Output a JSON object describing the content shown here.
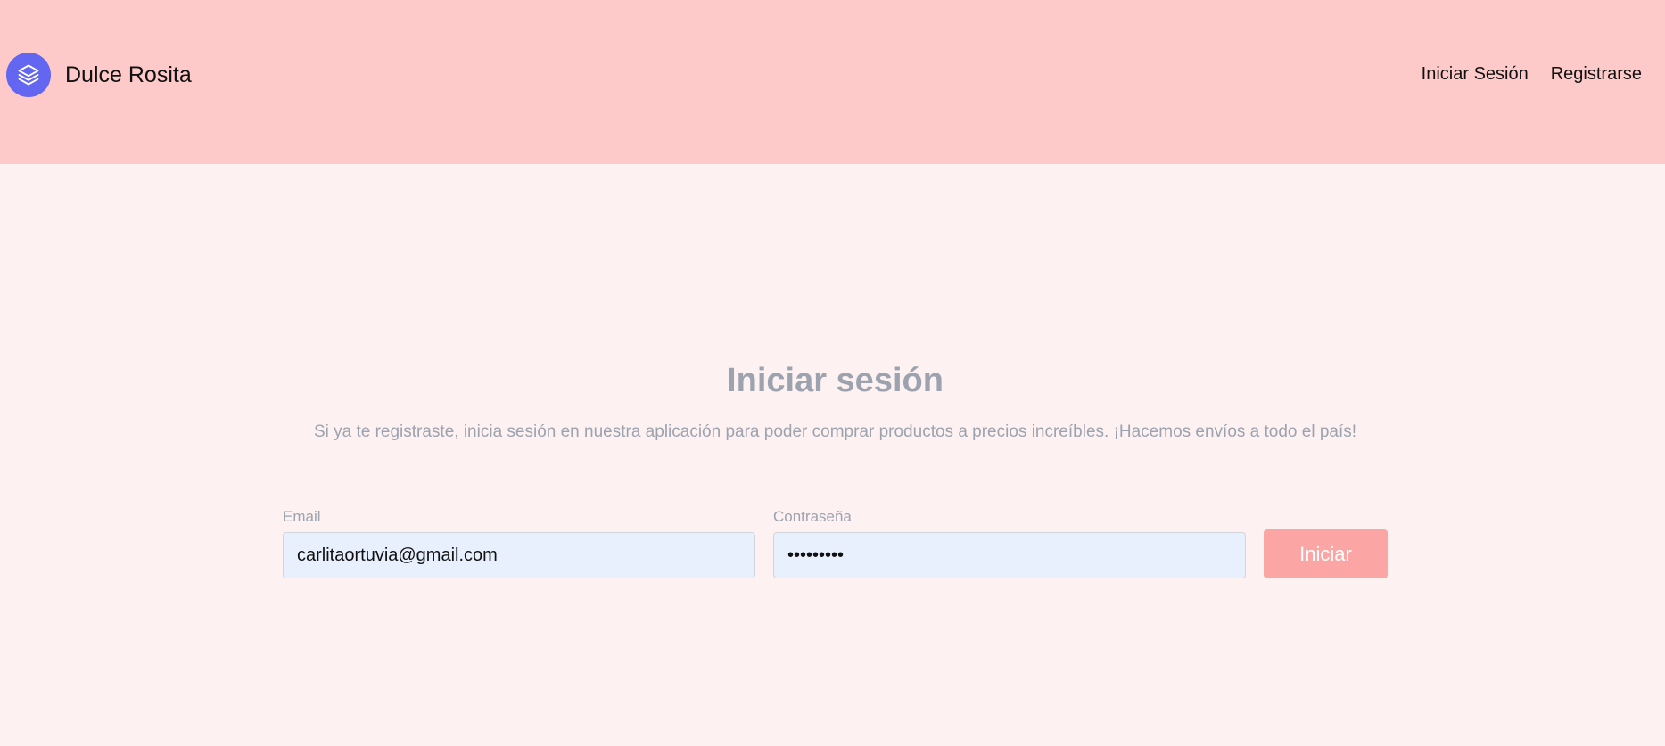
{
  "header": {
    "brand_name": "Dulce Rosita",
    "logo_icon": "layers-icon",
    "nav": {
      "login_label": "Iniciar Sesión",
      "register_label": "Registrarse"
    }
  },
  "main": {
    "title": "Iniciar sesión",
    "subtitle": "Si ya te registraste, inicia sesión en nuestra aplicación para poder comprar productos a precios increíbles. ¡Hacemos envíos a todo el país!",
    "email": {
      "label": "Email",
      "value": "carlitaortuvia@gmail.com"
    },
    "password": {
      "label": "Contraseña",
      "value": "•••••••••"
    },
    "submit_label": "Iniciar"
  },
  "colors": {
    "header_bg": "#fec9c9",
    "page_bg": "#fef1f1",
    "logo_bg": "#6366f1",
    "button_bg": "#fca5a5",
    "input_bg": "#e8f0fe",
    "muted_text": "#9ca3af"
  }
}
